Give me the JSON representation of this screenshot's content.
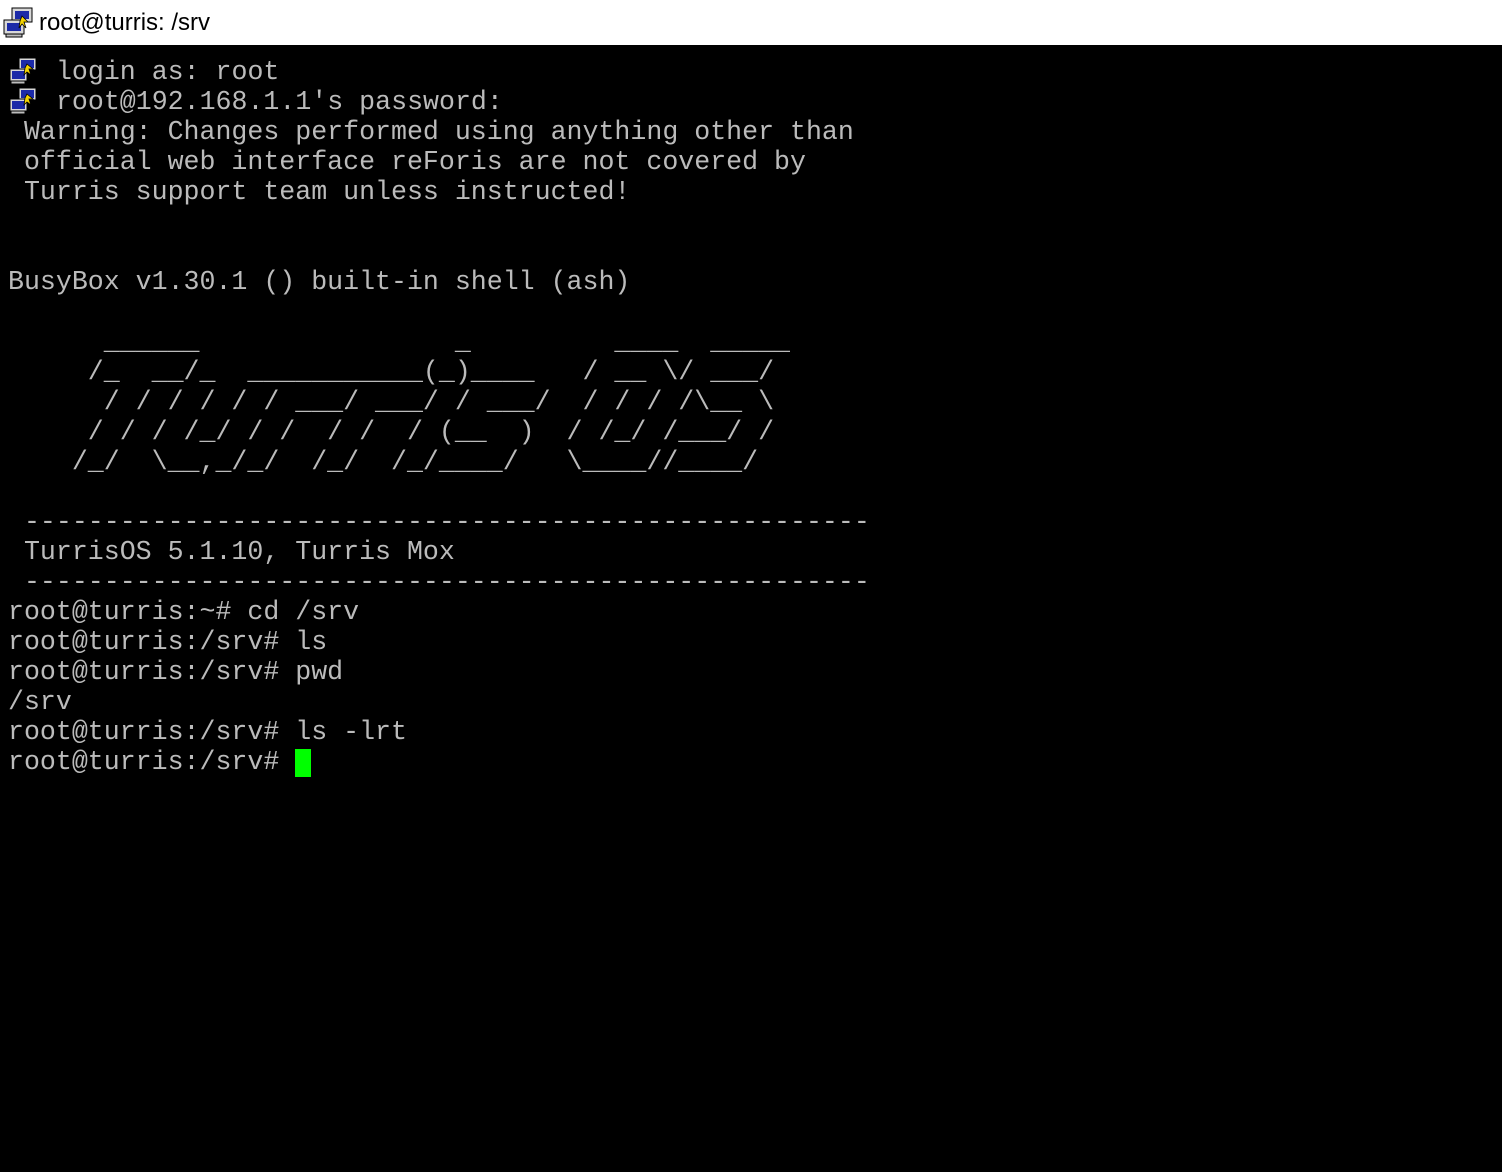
{
  "window": {
    "title": "root@turris: /srv",
    "app_icon": "putty-icon"
  },
  "terminal": {
    "cursor_color": "#00ff00",
    "text_color": "#bbbbbb",
    "background": "#000000",
    "lines": [
      {
        "icon": "putty-small-icon",
        "text": "login as: root"
      },
      {
        "icon": "putty-small-icon",
        "text": "root@192.168.1.1's password:"
      },
      {
        "text": " Warning: Changes performed using anything other than"
      },
      {
        "text": " official web interface reForis are not covered by"
      },
      {
        "text": " Turris support team unless instructed!"
      },
      {
        "text": ""
      },
      {
        "text": ""
      },
      {
        "text": "BusyBox v1.30.1 () built-in shell (ash)"
      },
      {
        "text": ""
      },
      {
        "text": "      ______                _         ____  _____"
      },
      {
        "text": "     /_  __/_  ___________(_)____   / __ \\/ ___/"
      },
      {
        "text": "      / / / / / / ___/ ___/ / ___/  / / / /\\__ \\"
      },
      {
        "text": "     / / / /_/ / /  / /  / (__  )  / /_/ /___/ /"
      },
      {
        "text": "    /_/  \\__,_/_/  /_/  /_/____/   \\____//____/"
      },
      {
        "text": ""
      },
      {
        "text": " -----------------------------------------------------"
      },
      {
        "text": " TurrisOS 5.1.10, Turris Mox"
      },
      {
        "text": " -----------------------------------------------------"
      },
      {
        "text": "root@turris:~# cd /srv"
      },
      {
        "text": "root@turris:/srv# ls"
      },
      {
        "text": "root@turris:/srv# pwd"
      },
      {
        "text": "/srv"
      },
      {
        "text": "root@turris:/srv# ls -lrt"
      },
      {
        "text": "root@turris:/srv# "
      }
    ]
  }
}
